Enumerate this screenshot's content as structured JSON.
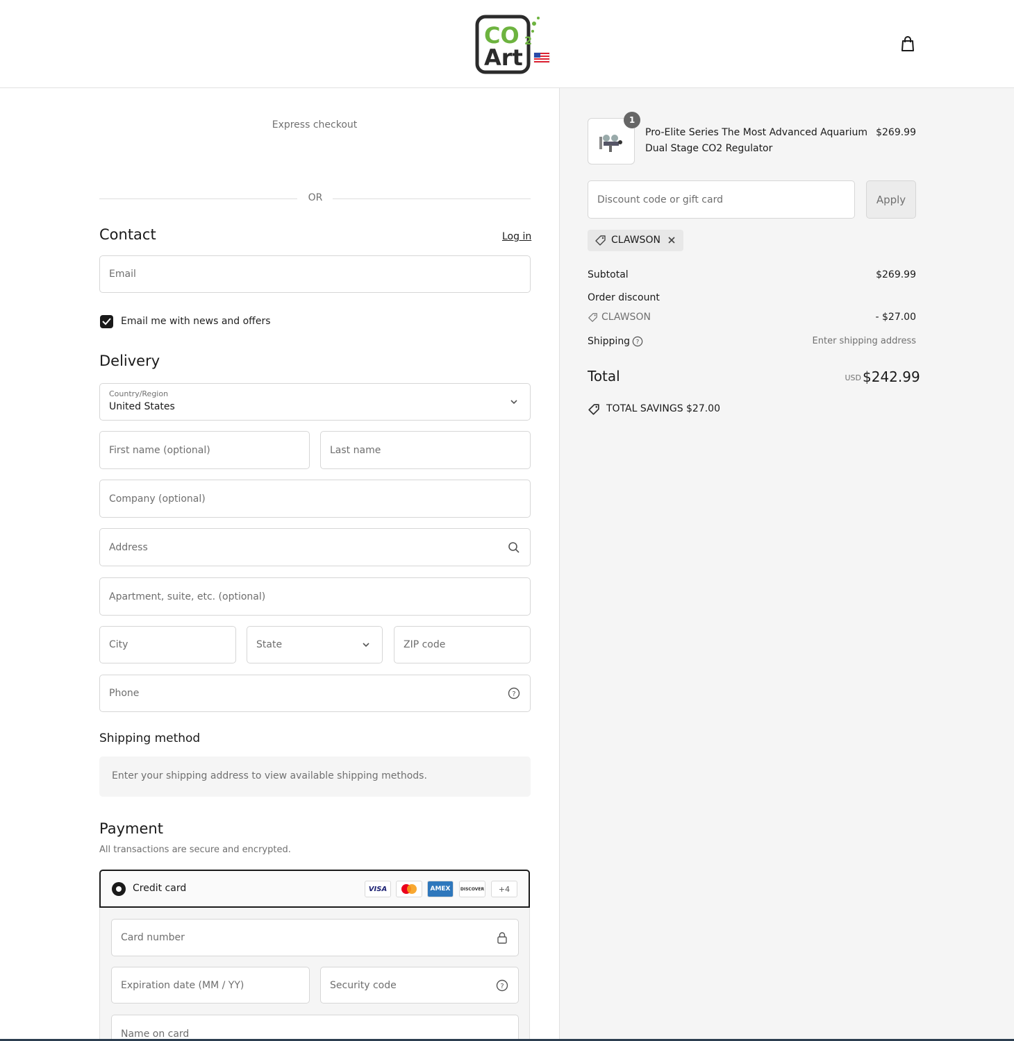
{
  "header": {
    "logo_main": "CO",
    "logo_sub": "2",
    "logo_second": "Art"
  },
  "checkout": {
    "express_label": "Express checkout",
    "or_label": "OR",
    "contact": {
      "title": "Contact",
      "login_label": "Log in",
      "email_placeholder": "Email",
      "news_checkbox_label": "Email me with news and offers"
    },
    "delivery": {
      "title": "Delivery",
      "country_label": "Country/Region",
      "country_value": "United States",
      "first_name_placeholder": "First name (optional)",
      "last_name_placeholder": "Last name",
      "company_placeholder": "Company (optional)",
      "address_placeholder": "Address",
      "apartment_placeholder": "Apartment, suite, etc. (optional)",
      "city_placeholder": "City",
      "state_placeholder": "State",
      "zip_placeholder": "ZIP code",
      "phone_placeholder": "Phone"
    },
    "shipping_method": {
      "title": "Shipping method",
      "notice": "Enter your shipping address to view available shipping methods."
    },
    "payment": {
      "title": "Payment",
      "subtitle": "All transactions are secure and encrypted.",
      "credit_card_label": "Credit card",
      "card_brands": [
        "VISA",
        "MC",
        "AMEX",
        "DISCOVER"
      ],
      "more_brands": "+4",
      "card_number_placeholder": "Card number",
      "expiration_placeholder": "Expiration date (MM / YY)",
      "security_code_placeholder": "Security code",
      "name_on_card_placeholder": "Name on card"
    }
  },
  "summary": {
    "item": {
      "quantity": "1",
      "name_line1": "Pro-Elite Series The Most Advanced Aquarium",
      "name_line2": "Dual Stage CO2 Regulator",
      "price": "$269.99"
    },
    "discount_placeholder": "Discount code or gift card",
    "apply_label": "Apply",
    "applied_code": "CLAWSON",
    "subtotal_label": "Subtotal",
    "subtotal_value": "$269.99",
    "order_discount_label": "Order discount",
    "discount_code": "CLAWSON",
    "discount_value": "- $27.00",
    "shipping_label": "Shipping",
    "shipping_value": "Enter shipping address",
    "total_label": "Total",
    "currency": "USD",
    "total_value": "$242.99",
    "savings_label": "TOTAL SAVINGS",
    "savings_value": "$27.00"
  },
  "colors": {
    "logo_green": "#6db33f",
    "logo_dark": "#2b2b2b",
    "panel_bg": "#f5f5f5"
  }
}
